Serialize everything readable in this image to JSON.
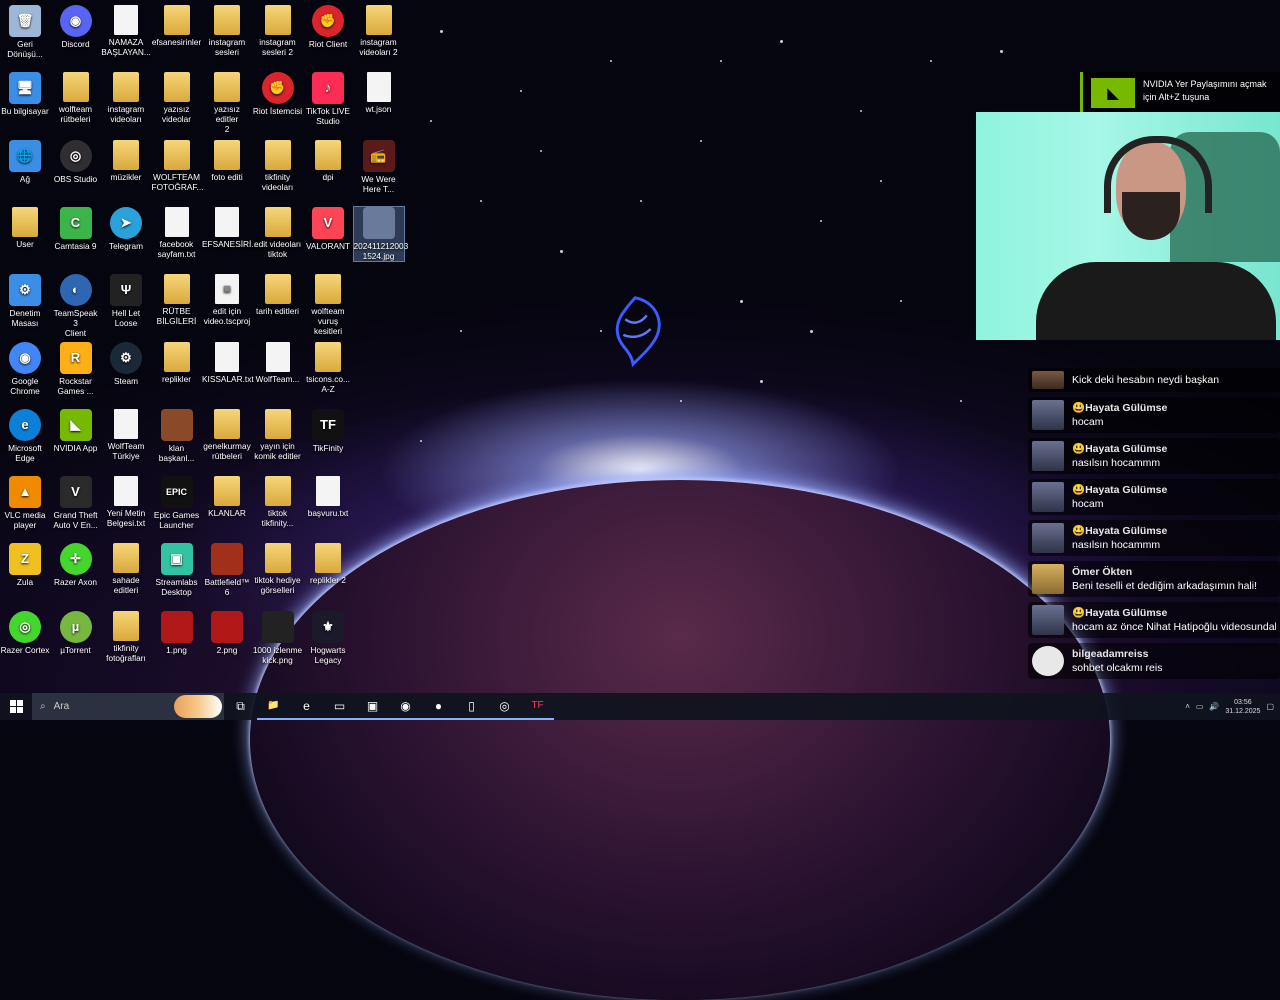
{
  "desktop_icons": [
    {
      "label": "Geri\nDönüşü...",
      "type": "bin",
      "color": "#9fb7d6",
      "glyph": "🗑",
      "col": 0,
      "row": 0
    },
    {
      "label": "Discord",
      "type": "round",
      "color": "#5865f2",
      "glyph": "◉",
      "col": 1,
      "row": 0
    },
    {
      "label": "NAMAZA\nBAŞLAYAN...",
      "type": "file",
      "color": "#f4f4f4",
      "glyph": "",
      "col": 2,
      "row": 0
    },
    {
      "label": "efsanesirinler",
      "type": "folder",
      "color": "#e6b84c",
      "glyph": "",
      "col": 3,
      "row": 0
    },
    {
      "label": "instagram\nsesleri",
      "type": "folder",
      "color": "#e6b84c",
      "glyph": "",
      "col": 4,
      "row": 0
    },
    {
      "label": "instagram\nsesleri 2",
      "type": "folder",
      "color": "#e6b84c",
      "glyph": "",
      "col": 5,
      "row": 0
    },
    {
      "label": "Riot Client",
      "type": "round",
      "color": "#d9252b",
      "glyph": "✊",
      "col": 6,
      "row": 0
    },
    {
      "label": "instagram\nvideoları 2",
      "type": "folder",
      "color": "#e6b84c",
      "glyph": "",
      "col": 7,
      "row": 0
    },
    {
      "label": "Bu bilgisayar",
      "type": "pc",
      "color": "#3a8ee6",
      "glyph": "🖥",
      "col": 0,
      "row": 1
    },
    {
      "label": "wolfteam\nrütbeleri",
      "type": "folder",
      "color": "#e6b84c",
      "glyph": "",
      "col": 1,
      "row": 1
    },
    {
      "label": "instagram\nvideoları",
      "type": "folder",
      "color": "#e6b84c",
      "glyph": "",
      "col": 2,
      "row": 1
    },
    {
      "label": "yazısız\nvideolar",
      "type": "folder",
      "color": "#e6b84c",
      "glyph": "",
      "col": 3,
      "row": 1
    },
    {
      "label": "yazısız editler\n2",
      "type": "folder",
      "color": "#e6b84c",
      "glyph": "",
      "col": 4,
      "row": 1
    },
    {
      "label": "Riot İstemcisi",
      "type": "round",
      "color": "#d9252b",
      "glyph": "✊",
      "col": 5,
      "row": 1
    },
    {
      "label": "TikTok LIVE\nStudio",
      "type": "app",
      "color": "#fe2c55",
      "glyph": "♪",
      "col": 6,
      "row": 1
    },
    {
      "label": "wt.json",
      "type": "file",
      "color": "#f4f4f4",
      "glyph": "",
      "col": 7,
      "row": 1
    },
    {
      "label": "Ağ",
      "type": "app",
      "color": "#3a8ee6",
      "glyph": "🌐",
      "col": 0,
      "row": 2
    },
    {
      "label": "OBS Studio",
      "type": "round",
      "color": "#302e31",
      "glyph": "◎",
      "col": 1,
      "row": 2
    },
    {
      "label": "müzikler",
      "type": "folder",
      "color": "#e6b84c",
      "glyph": "",
      "col": 2,
      "row": 2
    },
    {
      "label": "WOLFTEAM\nFOTOĞRAF...",
      "type": "folder",
      "color": "#e6b84c",
      "glyph": "",
      "col": 3,
      "row": 2
    },
    {
      "label": "foto editi",
      "type": "folder",
      "color": "#e6b84c",
      "glyph": "",
      "col": 4,
      "row": 2
    },
    {
      "label": "tikfinity\nvideoları",
      "type": "folder",
      "color": "#e6b84c",
      "glyph": "",
      "col": 5,
      "row": 2
    },
    {
      "label": "dpi",
      "type": "folder",
      "color": "#e6b84c",
      "glyph": "",
      "col": 6,
      "row": 2
    },
    {
      "label": "We Were\nHere T...",
      "type": "app",
      "color": "#5a1a1a",
      "glyph": "📻",
      "col": 7,
      "row": 2
    },
    {
      "label": "User",
      "type": "folder",
      "color": "#e6b84c",
      "glyph": "",
      "col": 0,
      "row": 3
    },
    {
      "label": "Camtasia 9",
      "type": "app",
      "color": "#3bb54a",
      "glyph": "C",
      "col": 1,
      "row": 3
    },
    {
      "label": "Telegram",
      "type": "round",
      "color": "#2aa1da",
      "glyph": "➤",
      "col": 2,
      "row": 3
    },
    {
      "label": "facebook\nsayfam.txt",
      "type": "file",
      "color": "#f4f4f4",
      "glyph": "",
      "col": 3,
      "row": 3
    },
    {
      "label": "EFSANESİRİ...",
      "type": "file",
      "color": "#f4f4f4",
      "glyph": "",
      "col": 4,
      "row": 3
    },
    {
      "label": "edit videoları\ntiktok",
      "type": "folder",
      "color": "#e6b84c",
      "glyph": "",
      "col": 5,
      "row": 3
    },
    {
      "label": "VALORANT",
      "type": "app",
      "color": "#fd4556",
      "glyph": "V",
      "col": 6,
      "row": 3
    },
    {
      "label": "202411212003\n1524.jpg",
      "type": "photo",
      "color": "#6a7a9a",
      "glyph": "",
      "col": 7,
      "row": 3,
      "selected": true
    },
    {
      "label": "Denetim\nMasası",
      "type": "app",
      "color": "#3a8ee6",
      "glyph": "⚙",
      "col": 0,
      "row": 4
    },
    {
      "label": "TeamSpeak 3\nClient",
      "type": "round",
      "color": "#2d66b2",
      "glyph": "◐",
      "col": 1,
      "row": 4
    },
    {
      "label": "Hell Let\nLoose",
      "type": "app",
      "color": "#222",
      "glyph": "Ψ",
      "col": 2,
      "row": 4
    },
    {
      "label": "RÜTBE\nBİLGİLERİ",
      "type": "folder",
      "color": "#e6b84c",
      "glyph": "",
      "col": 3,
      "row": 4
    },
    {
      "label": "edit için\nvideo.tscproj",
      "type": "file",
      "color": "#f4f4f4",
      "glyph": "▣",
      "col": 4,
      "row": 4
    },
    {
      "label": "tarih editleri",
      "type": "folder",
      "color": "#e6b84c",
      "glyph": "",
      "col": 5,
      "row": 4
    },
    {
      "label": "wolfteam\nvuruş kesitleri",
      "type": "folder",
      "color": "#e6b84c",
      "glyph": "",
      "col": 6,
      "row": 4
    },
    {
      "label": "Google\nChrome",
      "type": "round",
      "color": "#4285f4",
      "glyph": "◉",
      "col": 0,
      "row": 5
    },
    {
      "label": "Rockstar\nGames ...",
      "type": "app",
      "color": "#fcaf17",
      "glyph": "R",
      "col": 1,
      "row": 5
    },
    {
      "label": "Steam",
      "type": "round",
      "color": "#1b2838",
      "glyph": "⚙",
      "col": 2,
      "row": 5
    },
    {
      "label": "replikler",
      "type": "folder",
      "color": "#e6b84c",
      "glyph": "",
      "col": 3,
      "row": 5
    },
    {
      "label": "KISSALAR.txt",
      "type": "file",
      "color": "#f4f4f4",
      "glyph": "",
      "col": 4,
      "row": 5
    },
    {
      "label": "WolfTeam...",
      "type": "file",
      "color": "#f4f4f4",
      "glyph": "",
      "col": 5,
      "row": 5
    },
    {
      "label": "tsicons.co...\nA-Z",
      "type": "folder",
      "color": "#e6b84c",
      "glyph": "",
      "col": 6,
      "row": 5
    },
    {
      "label": "Microsoft\nEdge",
      "type": "round",
      "color": "#0c7fd6",
      "glyph": "e",
      "col": 0,
      "row": 6
    },
    {
      "label": "NVIDIA App",
      "type": "app",
      "color": "#76b900",
      "glyph": "◣",
      "col": 1,
      "row": 6
    },
    {
      "label": "WolfTeam\nTürkiye",
      "type": "file",
      "color": "#f4f4f4",
      "glyph": "",
      "col": 2,
      "row": 6
    },
    {
      "label": "klan\nbaşkanl...",
      "type": "photo",
      "color": "#8a4a2a",
      "glyph": "",
      "col": 3,
      "row": 6
    },
    {
      "label": "genelkurmay\nrütbeleri",
      "type": "folder",
      "color": "#e6b84c",
      "glyph": "",
      "col": 4,
      "row": 6
    },
    {
      "label": "yayın için\nkomik editler",
      "type": "folder",
      "color": "#e6b84c",
      "glyph": "",
      "col": 5,
      "row": 6
    },
    {
      "label": "TikFinity",
      "type": "app",
      "color": "#111",
      "glyph": "TF",
      "col": 6,
      "row": 6
    },
    {
      "label": "VLC media\nplayer",
      "type": "app",
      "color": "#f08a00",
      "glyph": "▲",
      "col": 0,
      "row": 7
    },
    {
      "label": "Grand Theft\nAuto V En...",
      "type": "app",
      "color": "#2a2a2a",
      "glyph": "V",
      "col": 1,
      "row": 7
    },
    {
      "label": "Yeni Metin\nBelgesi.txt",
      "type": "file",
      "color": "#f4f4f4",
      "glyph": "",
      "col": 2,
      "row": 7
    },
    {
      "label": "Epic Games\nLauncher",
      "type": "app",
      "color": "#111",
      "glyph": "EPIC",
      "col": 3,
      "row": 7
    },
    {
      "label": "KLANLAR",
      "type": "folder",
      "color": "#e6b84c",
      "glyph": "",
      "col": 4,
      "row": 7
    },
    {
      "label": "tiktok\ntikfinity...",
      "type": "folder",
      "color": "#e6b84c",
      "glyph": "",
      "col": 5,
      "row": 7
    },
    {
      "label": "başvuru.txt",
      "type": "file",
      "color": "#f4f4f4",
      "glyph": "",
      "col": 6,
      "row": 7
    },
    {
      "label": "Zula",
      "type": "app",
      "color": "#f0c020",
      "glyph": "Z",
      "col": 0,
      "row": 8
    },
    {
      "label": "Razer Axon",
      "type": "round",
      "color": "#44d62c",
      "glyph": "✛",
      "col": 1,
      "row": 8
    },
    {
      "label": "sahade\neditleri",
      "type": "folder",
      "color": "#e6b84c",
      "glyph": "",
      "col": 2,
      "row": 8
    },
    {
      "label": "Streamlabs\nDesktop",
      "type": "app",
      "color": "#31c3a2",
      "glyph": "▣",
      "col": 3,
      "row": 8
    },
    {
      "label": "Battlefield™ 6",
      "type": "photo",
      "color": "#a0301a",
      "glyph": "",
      "col": 4,
      "row": 8
    },
    {
      "label": "tiktok hediye\ngörselleri",
      "type": "folder",
      "color": "#e6b84c",
      "glyph": "",
      "col": 5,
      "row": 8
    },
    {
      "label": "replikler 2",
      "type": "folder",
      "color": "#e6b84c",
      "glyph": "",
      "col": 6,
      "row": 8
    },
    {
      "label": "Razer Cortex",
      "type": "round",
      "color": "#44d62c",
      "glyph": "◎",
      "col": 0,
      "row": 9
    },
    {
      "label": "µTorrent",
      "type": "round",
      "color": "#76b83f",
      "glyph": "µ",
      "col": 1,
      "row": 9
    },
    {
      "label": "tikfinity\nfotoğrafları",
      "type": "folder",
      "color": "#e6b84c",
      "glyph": "",
      "col": 2,
      "row": 9
    },
    {
      "label": "1.png",
      "type": "photo",
      "color": "#b01818",
      "glyph": "",
      "col": 3,
      "row": 9
    },
    {
      "label": "2.png",
      "type": "photo",
      "color": "#b01818",
      "glyph": "",
      "col": 4,
      "row": 9
    },
    {
      "label": "1000 izlenme\nkick.png",
      "type": "photo",
      "color": "#222",
      "glyph": "",
      "col": 5,
      "row": 9
    },
    {
      "label": "Hogwarts\nLegacy",
      "type": "app",
      "color": "#1a1a2a",
      "glyph": "⚜",
      "col": 6,
      "row": 9
    }
  ],
  "nvidia_overlay": {
    "text": "NVIDIA Yer Paylaşımını açmak için Alt+Z tuşuna",
    "accent": "#76b900"
  },
  "chat": [
    {
      "name": "",
      "text": "Kick deki hesabın neydi başkan",
      "avatar": "brown",
      "small": true
    },
    {
      "name": "😃Hayata Gülümse",
      "text": "hocam",
      "avatar": "blue"
    },
    {
      "name": "😃Hayata Gülümse",
      "text": "nasılsın hocammm",
      "avatar": "blue"
    },
    {
      "name": "😃Hayata Gülümse",
      "text": "hocam",
      "avatar": "blue"
    },
    {
      "name": "😃Hayata Gülümse",
      "text": "nasılsın hocammm",
      "avatar": "blue"
    },
    {
      "name": "Ömer Ökten",
      "text": "Beni teselli et dediğim arkadaşımın hali!",
      "avatar": "gold"
    },
    {
      "name": "😃Hayata Gülümse",
      "text": "hocam az önce Nihat Hatipoğlu videosundal",
      "avatar": "blue"
    },
    {
      "name": "bilgeadamreiss",
      "text": "sohbet olcakmı reis",
      "avatar": "grey"
    }
  ],
  "taskbar": {
    "search_placeholder": "Ara",
    "items": [
      {
        "name": "task-view",
        "glyph": "⧉"
      },
      {
        "name": "file-explorer",
        "glyph": "📁"
      },
      {
        "name": "edge",
        "glyph": "e"
      },
      {
        "name": "app-window",
        "glyph": "▭"
      },
      {
        "name": "app-blue",
        "glyph": "▣"
      },
      {
        "name": "chrome",
        "glyph": "◉"
      },
      {
        "name": "app-orb",
        "glyph": "●"
      },
      {
        "name": "notepad",
        "glyph": "▯"
      },
      {
        "name": "obs",
        "glyph": "◎"
      },
      {
        "name": "tikfinity",
        "glyph": "TF"
      }
    ],
    "time": "03:56",
    "date": "31.12.2025"
  }
}
